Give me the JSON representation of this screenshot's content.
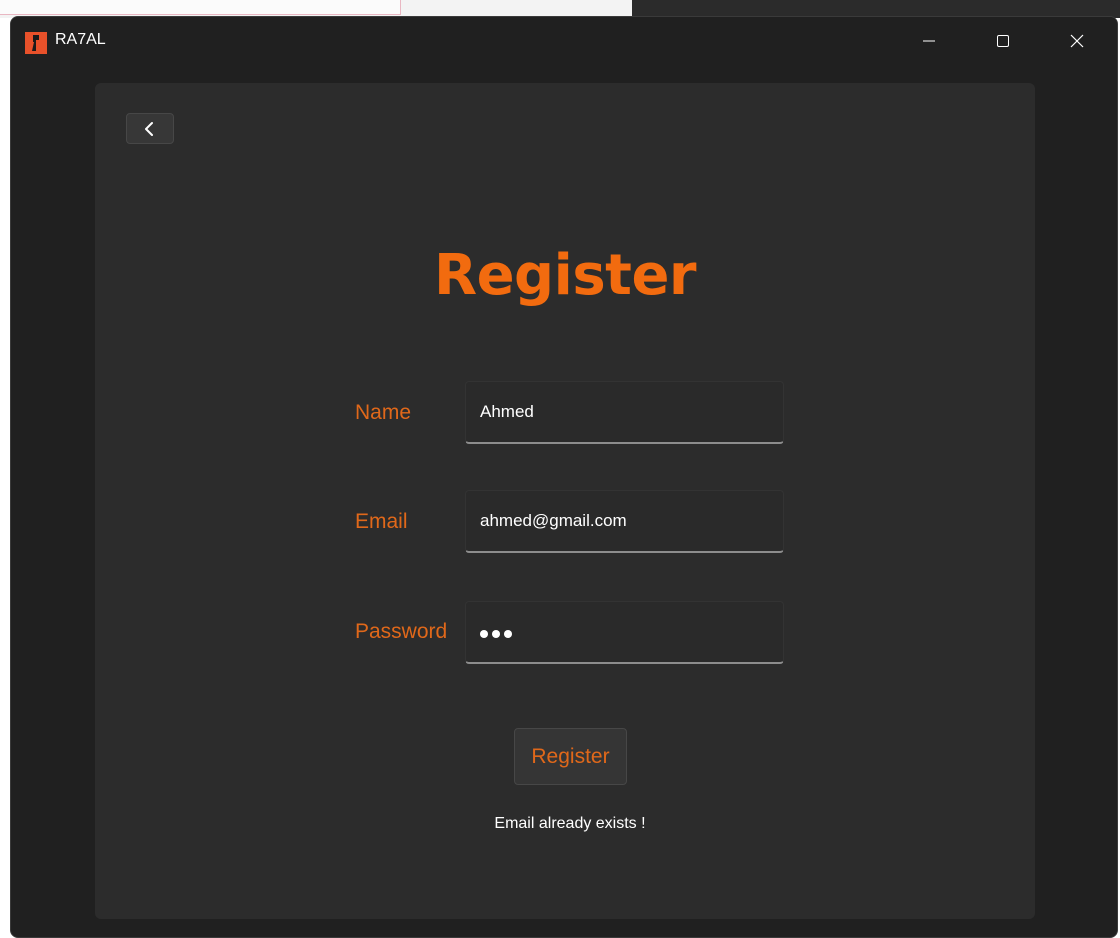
{
  "window": {
    "title": "RA7AL",
    "icon": "app-logo-icon",
    "controls": [
      "minimize-icon",
      "maximize-icon",
      "close-icon"
    ]
  },
  "page": {
    "back_icon": "chevron-left-icon",
    "heading": "Register",
    "fields": {
      "name": {
        "label": "Name",
        "value": "Ahmed"
      },
      "email": {
        "label": "Email",
        "value": "ahmed@gmail.com"
      },
      "password": {
        "label": "Password",
        "masked_length": 3
      }
    },
    "submit_label": "Register",
    "status_message": "Email already exists !"
  },
  "colors": {
    "accent": "#f26b0f",
    "background": "#202020",
    "panel": "#2c2c2c"
  }
}
